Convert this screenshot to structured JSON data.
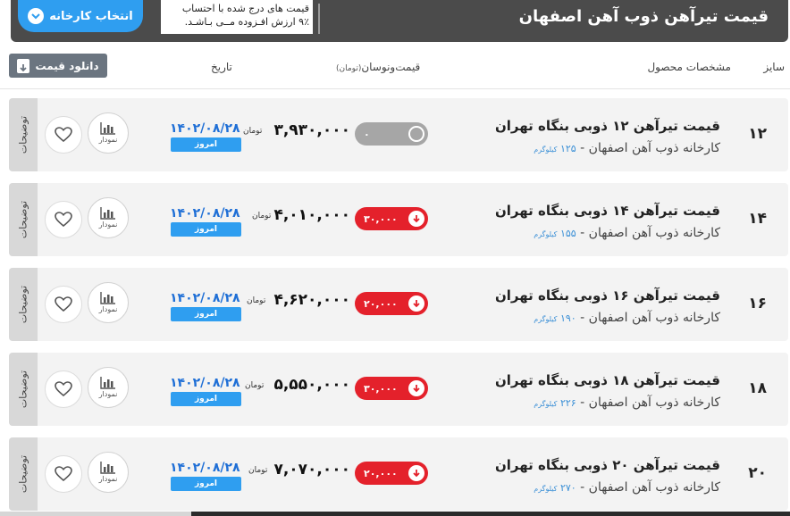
{
  "header": {
    "title": "قیمت تیرآهن ذوب آهن اصفهان",
    "vat_note_line1": "قیمت های درج شده با احتساب",
    "vat_note_line2": "۹٪ ارزش افـزوده مــی بـاشـد.",
    "factory_button": "انتخاب کارخانه"
  },
  "columns": {
    "size": "سایز",
    "spec": "مشخصات محصول",
    "price": "قیمت‌ونوسان",
    "price_unit": "(تومان)",
    "date": "تاریخ",
    "download": "دانلود قیمت"
  },
  "labels": {
    "details": "توضیحات",
    "chart": "نمودار",
    "today": "امروز",
    "currency": "تومان",
    "weight_unit": "کیلوگرم"
  },
  "colors": {
    "accent": "#2f9ef0",
    "down": "#e4212b",
    "neutral": "#a6a6a6",
    "date": "#1f6fd6"
  },
  "rows": [
    {
      "size": "۱۲",
      "name": "قیمت تیرآهن ۱۲ ذوبی بنگاه تهران",
      "sub": "کارخانه ذوب آهن اصفهان - ",
      "weight": "۱۲۵",
      "price": "۳,۹۳۰,۰۰۰",
      "change": "۰",
      "trend": "neutral",
      "date": "۱۴۰۲/۰۸/۲۸"
    },
    {
      "size": "۱۴",
      "name": "قیمت تیرآهن ۱۴ ذوبی بنگاه تهران",
      "sub": "کارخانه ذوب آهن اصفهان - ",
      "weight": "۱۵۵",
      "price": "۴,۰۱۰,۰۰۰",
      "change": "۳۰,۰۰۰",
      "trend": "down",
      "date": "۱۴۰۲/۰۸/۲۸"
    },
    {
      "size": "۱۶",
      "name": "قیمت تیرآهن ۱۶ ذوبی بنگاه تهران",
      "sub": "کارخانه ذوب آهن اصفهان - ",
      "weight": "۱۹۰",
      "price": "۴,۶۲۰,۰۰۰",
      "change": "۲۰,۰۰۰",
      "trend": "down",
      "date": "۱۴۰۲/۰۸/۲۸"
    },
    {
      "size": "۱۸",
      "name": "قیمت تیرآهن ۱۸ ذوبی بنگاه تهران",
      "sub": "کارخانه ذوب آهن اصفهان - ",
      "weight": "۲۲۶",
      "price": "۵,۵۵۰,۰۰۰",
      "change": "۳۰,۰۰۰",
      "trend": "down",
      "date": "۱۴۰۲/۰۸/۲۸"
    },
    {
      "size": "۲۰",
      "name": "قیمت تیرآهن ۲۰ ذوبی بنگاه تهران",
      "sub": "کارخانه ذوب آهن اصفهان - ",
      "weight": "۲۷۰",
      "price": "۷,۰۷۰,۰۰۰",
      "change": "۲۰,۰۰۰",
      "trend": "down",
      "date": "۱۴۰۲/۰۸/۲۸"
    }
  ]
}
